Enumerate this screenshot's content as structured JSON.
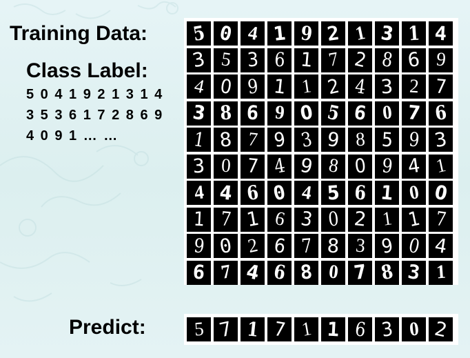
{
  "labels": {
    "training": "Training Data:",
    "class": "Class Label:",
    "class_lines": [
      "5 0 4 1 9 2 1 3 1 4",
      "3 5 3 6 1 7 2 8 6 9",
      "4 0 9 1 … …"
    ],
    "predict": "Predict:"
  },
  "training_grid": [
    [
      "5",
      "0",
      "4",
      "1",
      "9",
      "2",
      "1",
      "3",
      "1",
      "4"
    ],
    [
      "3",
      "5",
      "3",
      "6",
      "1",
      "7",
      "2",
      "8",
      "6",
      "9"
    ],
    [
      "4",
      "0",
      "9",
      "1",
      "1",
      "2",
      "4",
      "3",
      "2",
      "7"
    ],
    [
      "3",
      "8",
      "6",
      "9",
      "0",
      "5",
      "6",
      "0",
      "7",
      "6"
    ],
    [
      "1",
      "8",
      "7",
      "9",
      "3",
      "9",
      "8",
      "5",
      "9",
      "3"
    ],
    [
      "3",
      "0",
      "7",
      "4",
      "9",
      "8",
      "0",
      "9",
      "4",
      "1"
    ],
    [
      "4",
      "4",
      "6",
      "0",
      "4",
      "5",
      "6",
      "1",
      "0",
      "0"
    ],
    [
      "1",
      "7",
      "1",
      "6",
      "3",
      "0",
      "2",
      "1",
      "1",
      "7"
    ],
    [
      "9",
      "0",
      "2",
      "6",
      "7",
      "8",
      "3",
      "9",
      "0",
      "4"
    ],
    [
      "6",
      "7",
      "4",
      "6",
      "8",
      "0",
      "7",
      "8",
      "3",
      "1"
    ]
  ],
  "predict_row": [
    "5",
    "7",
    "1",
    "7",
    "1",
    "1",
    "6",
    "3",
    "0",
    "2"
  ]
}
